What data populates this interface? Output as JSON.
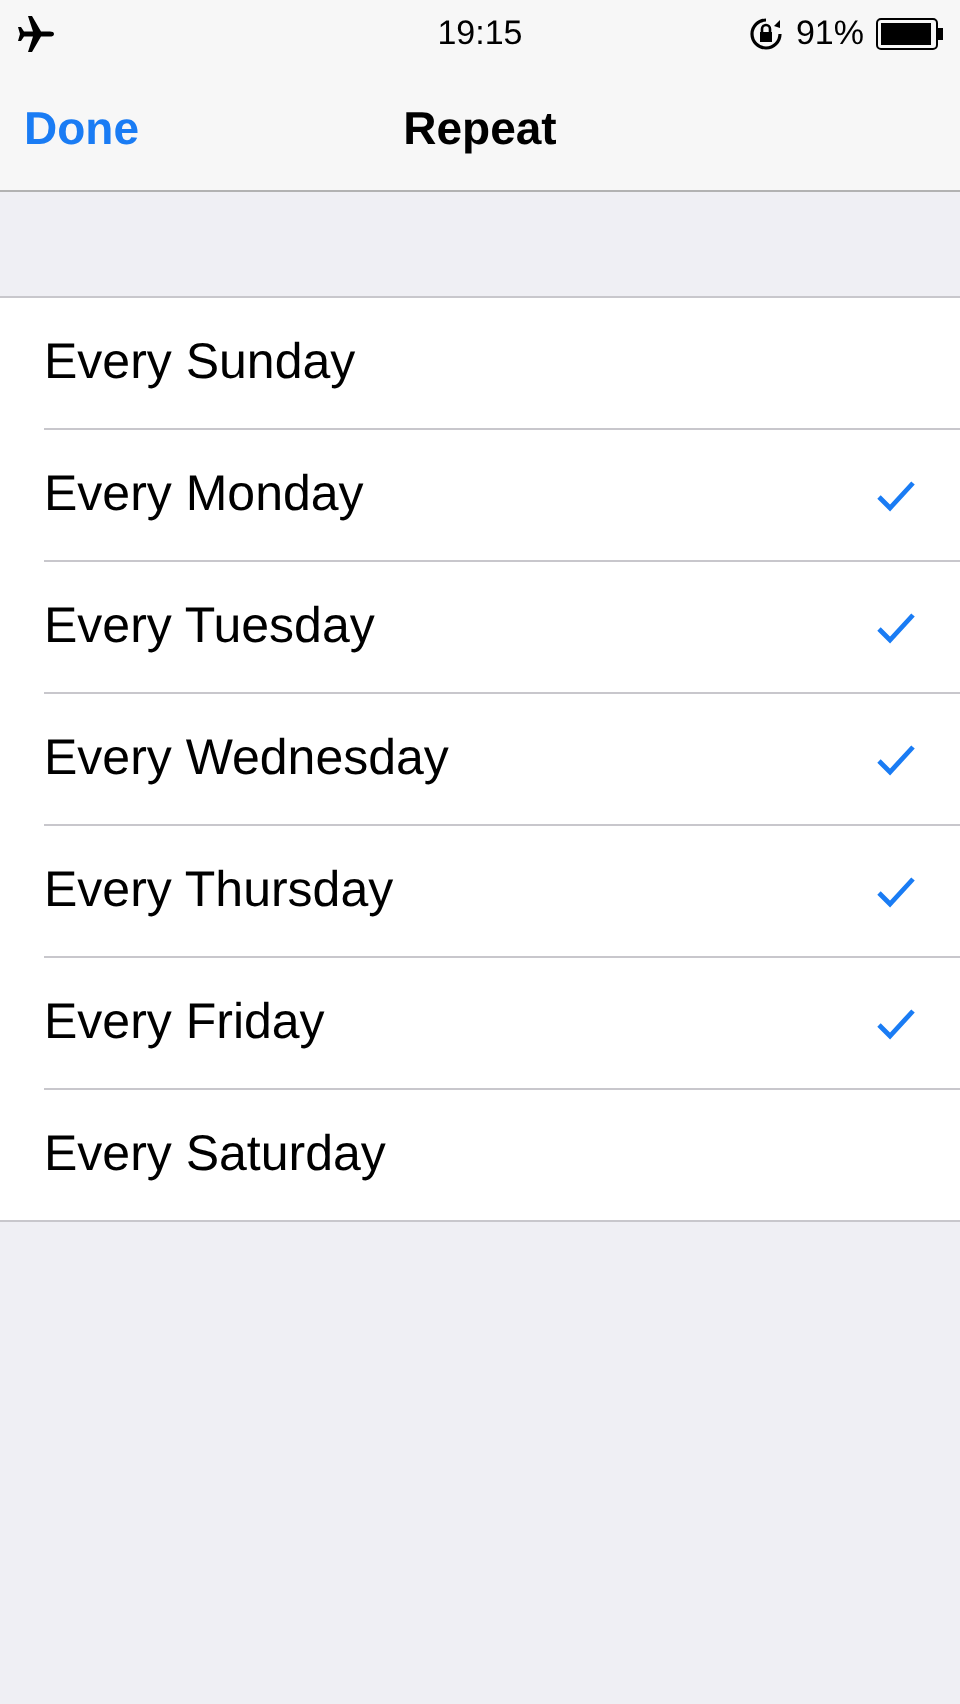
{
  "status_bar": {
    "time": "19:15",
    "battery": "91%"
  },
  "nav": {
    "done": "Done",
    "title": "Repeat"
  },
  "days": [
    {
      "label": "Every Sunday",
      "checked": false
    },
    {
      "label": "Every Monday",
      "checked": true
    },
    {
      "label": "Every Tuesday",
      "checked": true
    },
    {
      "label": "Every Wednesday",
      "checked": true
    },
    {
      "label": "Every Thursday",
      "checked": true
    },
    {
      "label": "Every Friday",
      "checked": true
    },
    {
      "label": "Every Saturday",
      "checked": false
    }
  ]
}
